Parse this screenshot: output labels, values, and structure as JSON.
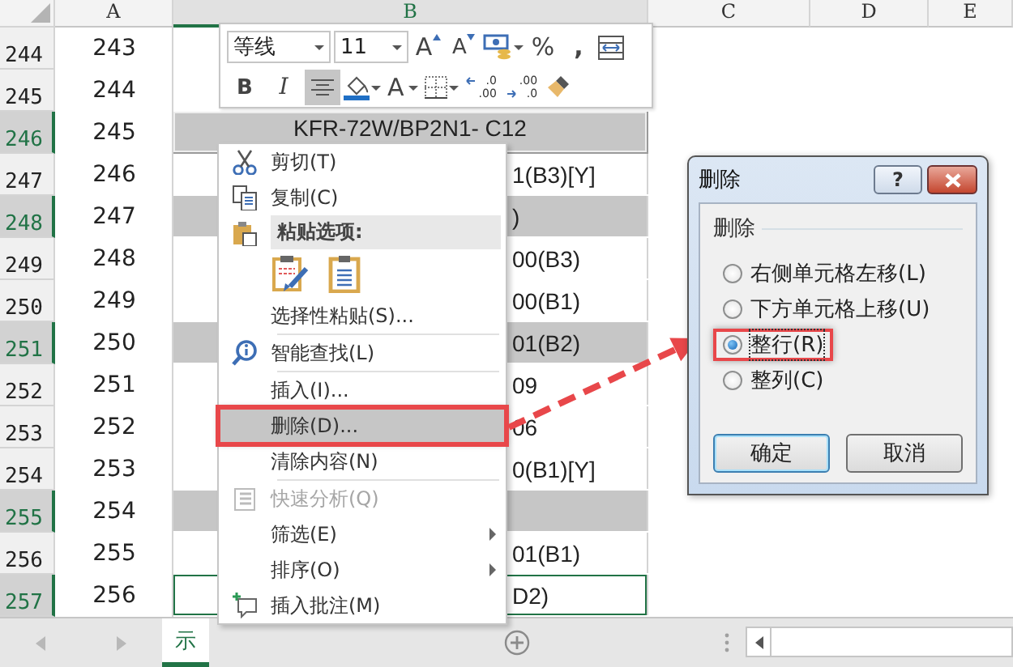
{
  "column_headers": [
    {
      "label": "A",
      "selected": false
    },
    {
      "label": "B",
      "selected": true
    },
    {
      "label": "C",
      "selected": false
    },
    {
      "label": "D",
      "selected": false
    },
    {
      "label": "E",
      "selected": false
    }
  ],
  "rows": [
    {
      "number": "244",
      "a": "243",
      "b": "",
      "selected": false,
      "active": false
    },
    {
      "number": "245",
      "a": "244",
      "b": "",
      "selected": false,
      "active": false
    },
    {
      "number": "246",
      "a": "245",
      "b": "KFR-72W/BP2N1- C12",
      "selected": true,
      "active": false
    },
    {
      "number": "247",
      "a": "246",
      "b": "1(B3)[Y]",
      "selected": false,
      "active": false
    },
    {
      "number": "248",
      "a": "247",
      "b": ")",
      "selected": true,
      "active": false
    },
    {
      "number": "249",
      "a": "248",
      "b": "00(B3)",
      "selected": false,
      "active": false
    },
    {
      "number": "250",
      "a": "249",
      "b": "00(B1)",
      "selected": false,
      "active": false
    },
    {
      "number": "251",
      "a": "250",
      "b": "01(B2)",
      "selected": true,
      "active": false
    },
    {
      "number": "252",
      "a": "251",
      "b": "09",
      "selected": false,
      "active": false
    },
    {
      "number": "253",
      "a": "252",
      "b": "06",
      "selected": false,
      "active": false
    },
    {
      "number": "254",
      "a": "253",
      "b": "0(B1)[Y]",
      "selected": false,
      "active": false
    },
    {
      "number": "255",
      "a": "254",
      "b": "",
      "selected": true,
      "active": false
    },
    {
      "number": "256",
      "a": "255",
      "b": "01(B1)",
      "selected": false,
      "active": false
    },
    {
      "number": "257",
      "a": "256",
      "b": "D2)",
      "selected": true,
      "active": true
    }
  ],
  "mini_toolbar": {
    "font": "等线",
    "size": "11",
    "grow_font": "A",
    "shrink_font": "A",
    "percent": "%",
    "comma": ",",
    "bold": "B",
    "italic": "I",
    "alignment": {
      "selected": true
    },
    "font_color": "A",
    "decrease_decimal": [
      ".0",
      ".00"
    ],
    "increase_decimal": [
      ".00",
      ".0"
    ]
  },
  "context_menu": {
    "items": [
      {
        "kind": "item",
        "label": "剪切(T)",
        "disabled": false,
        "selected": false,
        "submenu": false,
        "callout": false
      },
      {
        "kind": "item",
        "label": "复制(C)",
        "disabled": false,
        "selected": false,
        "submenu": false,
        "callout": false
      },
      {
        "kind": "header",
        "label": "粘贴选项:"
      },
      {
        "kind": "paste_options"
      },
      {
        "kind": "item",
        "label": "选择性粘贴(S)...",
        "disabled": false,
        "selected": false,
        "submenu": false,
        "callout": false
      },
      {
        "kind": "separator"
      },
      {
        "kind": "item",
        "label": "智能查找(L)",
        "disabled": false,
        "selected": false,
        "submenu": false,
        "callout": false
      },
      {
        "kind": "separator"
      },
      {
        "kind": "item",
        "label": "插入(I)...",
        "disabled": false,
        "selected": false,
        "submenu": false,
        "callout": false
      },
      {
        "kind": "item",
        "label": "删除(D)...",
        "disabled": false,
        "selected": true,
        "submenu": false,
        "callout": true
      },
      {
        "kind": "item",
        "label": "清除内容(N)",
        "disabled": false,
        "selected": false,
        "submenu": false,
        "callout": false
      },
      {
        "kind": "separator"
      },
      {
        "kind": "item",
        "label": "快速分析(Q)",
        "disabled": true,
        "selected": false,
        "submenu": false,
        "callout": false
      },
      {
        "kind": "item",
        "label": "筛选(E)",
        "disabled": false,
        "selected": false,
        "submenu": true,
        "callout": false
      },
      {
        "kind": "item",
        "label": "排序(O)",
        "disabled": false,
        "selected": false,
        "submenu": true,
        "callout": false
      },
      {
        "kind": "item",
        "label": "插入批注(M)",
        "disabled": false,
        "selected": false,
        "submenu": false,
        "callout": false
      }
    ]
  },
  "dialog": {
    "title": "删除",
    "help": "?",
    "group": "删除",
    "options": [
      {
        "label": "右侧单元格左移(L)",
        "selected": false,
        "callout": false
      },
      {
        "label": "下方单元格上移(U)",
        "selected": false,
        "callout": false
      },
      {
        "label": "整行(R)",
        "selected": true,
        "callout": true
      },
      {
        "label": "整列(C)",
        "selected": false,
        "callout": false
      }
    ],
    "buttons": [
      {
        "label": "确定",
        "default": true
      },
      {
        "label": "取消",
        "default": false
      }
    ]
  },
  "sheet_tabs": [
    {
      "label": "示",
      "selected": true
    }
  ]
}
